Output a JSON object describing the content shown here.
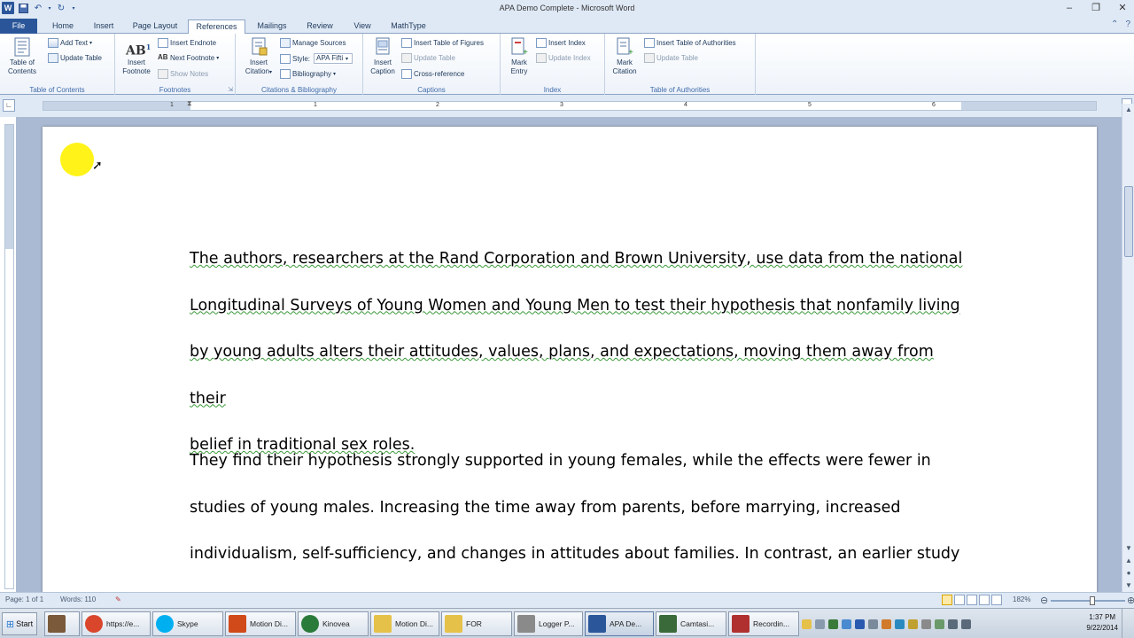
{
  "window": {
    "title": "APA Demo Complete - Microsoft Word",
    "minimize": "–",
    "maximize": "❐",
    "close": "✕"
  },
  "tabs": [
    "File",
    "Home",
    "Insert",
    "Page Layout",
    "References",
    "Mailings",
    "Review",
    "View",
    "MathType"
  ],
  "active_tab": "References",
  "ribbon": {
    "toc": {
      "big_label": "Table of Contents",
      "add_text": "Add Text",
      "update_table": "Update Table",
      "group_label": "Table of Contents"
    },
    "footnotes": {
      "insert_footnote": "Insert Footnote",
      "insert_endnote": "Insert Endnote",
      "next_footnote": "Next Footnote",
      "show_notes": "Show Notes",
      "group_label": "Footnotes"
    },
    "citations": {
      "insert_citation": "Insert Citation",
      "manage_sources": "Manage Sources",
      "style_label": "Style:",
      "style_value": "APA Fifti",
      "bibliography": "Bibliography",
      "group_label": "Citations & Bibliography"
    },
    "captions": {
      "insert_caption": "Insert Caption",
      "insert_tof": "Insert Table of Figures",
      "update_table": "Update Table",
      "cross_reference": "Cross-reference",
      "group_label": "Captions"
    },
    "index": {
      "mark_entry": "Mark Entry",
      "insert_index": "Insert Index",
      "update_index": "Update Index",
      "group_label": "Index"
    },
    "toa": {
      "mark_citation": "Mark Citation",
      "insert_toa": "Insert Table of Authorities",
      "update_table": "Update Table",
      "group_label": "Table of Authorities"
    }
  },
  "ruler": {
    "numbers": [
      "1",
      "1",
      "2",
      "3",
      "4",
      "5",
      "6"
    ]
  },
  "document": {
    "paragraph1_lines": [
      "The authors, researchers at the Rand Corporation and Brown University, use data from the national",
      "Longitudinal Surveys of Young Women and Young Men to test their hypothesis that nonfamily living",
      "by young adults alters their attitudes, values, plans, and expectations, moving them away from their",
      "belief in traditional sex roles."
    ],
    "paragraph2_lines": [
      "They find their hypothesis strongly supported in young females, while the effects were fewer in",
      "studies of young males. Increasing the time away from parents, before marrying, increased",
      "individualism, self-sufficiency, and changes in attitudes about families. In contrast, an earlier study"
    ]
  },
  "status": {
    "page": "Page: 1 of 1",
    "words": "Words: 110",
    "zoom": "182%"
  },
  "taskbar": {
    "start": "Start",
    "items": [
      {
        "label": "",
        "color": "#7a5a3a"
      },
      {
        "label": "https://e...",
        "color": "#d9462c"
      },
      {
        "label": "Skype",
        "color": "#00aff0"
      },
      {
        "label": "Motion Di...",
        "color": "#d04a1a"
      },
      {
        "label": "Kinovea",
        "color": "#2a7a3a"
      },
      {
        "label": "Motion Di...",
        "color": "#e6c14a"
      },
      {
        "label": "FOR",
        "color": "#e6c14a"
      },
      {
        "label": "Logger P...",
        "color": "#8a8a8a"
      },
      {
        "label": "APA De...",
        "color": "#2b579a"
      },
      {
        "label": "Camtasi...",
        "color": "#3a6a3a"
      },
      {
        "label": "Recordin...",
        "color": "#b03030"
      }
    ],
    "clock_time": "1:37 PM",
    "clock_date": "9/22/2014"
  },
  "colors": {
    "accent": "#2b579a",
    "highlight": "#fff200",
    "grammar_underline": "#3a9a3a"
  }
}
